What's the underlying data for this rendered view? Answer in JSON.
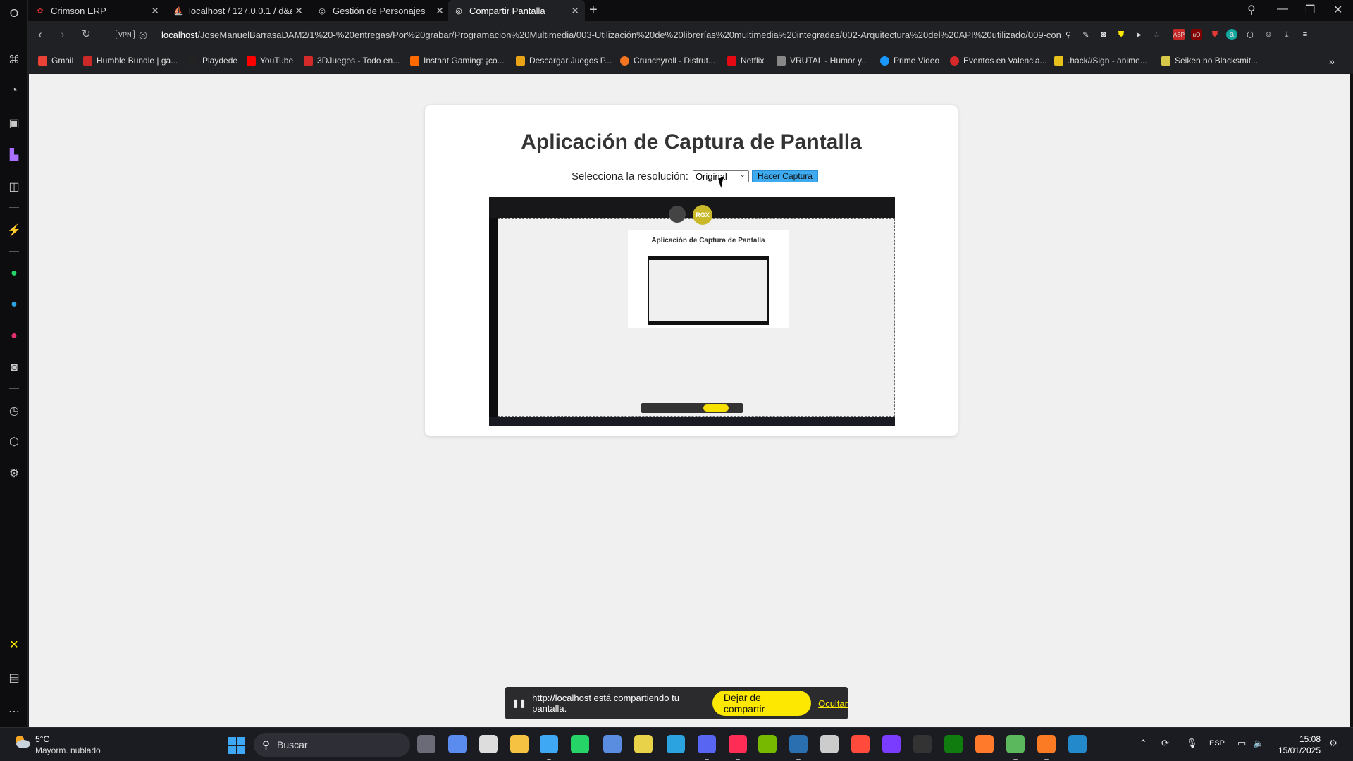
{
  "browser": {
    "tabs": [
      {
        "title": "Crimson ERP",
        "active": false
      },
      {
        "title": "localhost / 127.0.0.1 / d&a",
        "active": false
      },
      {
        "title": "Gestión de Personajes",
        "active": false
      },
      {
        "title": "Compartir Pantalla",
        "active": true
      }
    ],
    "vpn_label": "VPN",
    "url_host": "localhost",
    "url_path": "/JoseManuelBarrasaDAM2/1%20-%20entregas/Por%20grabar/Programacion%20Multimedia/003-Utilización%20de%20librerías%20multimedia%20integradas/002-Arquitectura%20del%20API%20utilizado/009-con",
    "extensions": [
      "ABP",
      "uO",
      "C",
      "a"
    ],
    "bookmarks": [
      {
        "label": "Gmail",
        "color": "#ea4335"
      },
      {
        "label": "Humble Bundle | ga...",
        "color": "#cc2929"
      },
      {
        "label": "Playdede",
        "color": "#222222"
      },
      {
        "label": "YouTube",
        "color": "#ff0000"
      },
      {
        "label": "3DJuegos - Todo en...",
        "color": "#d42a2a"
      },
      {
        "label": "Instant Gaming: ¡co...",
        "color": "#ff6a00"
      },
      {
        "label": "Descargar Juegos P...",
        "color": "#e8a317"
      },
      {
        "label": "Crunchyroll - Disfrut...",
        "color": "#f47521"
      },
      {
        "label": "Netflix",
        "color": "#e50914"
      },
      {
        "label": "VRUTAL - Humor y...",
        "color": "#888888"
      },
      {
        "label": "Prime Video",
        "color": "#1a98ff"
      },
      {
        "label": "Eventos en Valencia...",
        "color": "#d62a2a"
      },
      {
        "label": ".hack//Sign - anime...",
        "color": "#e8c21a"
      },
      {
        "label": "Seiken no Blacksmit...",
        "color": "#d8c84a"
      }
    ]
  },
  "page": {
    "title": "Aplicación de Captura de Pantalla",
    "resolution_label": "Selecciona la resolución:",
    "resolution_value": "Original",
    "capture_button": "Hacer Captura",
    "preview": {
      "title": "Aplicación de Captura de Pantalla",
      "badge": "RGX"
    }
  },
  "share_bar": {
    "text": "http://localhost está compartiendo tu pantalla.",
    "stop_button": "Dejar de compartir",
    "hide_link": "Ocultar"
  },
  "taskbar": {
    "weather_temp": "5°C",
    "weather_desc": "Mayorm. nublado",
    "search_placeholder": "Buscar",
    "language": "ESP",
    "time": "15:08",
    "date": "15/01/2025",
    "apps": [
      {
        "name": "task-view",
        "color": "#6b6b78"
      },
      {
        "name": "copilot",
        "color": "#5a8cf0"
      },
      {
        "name": "chatgpt",
        "color": "#dddddd"
      },
      {
        "name": "file-explorer",
        "color": "#f5c242"
      },
      {
        "name": "store",
        "color": "#3fa8f4"
      },
      {
        "name": "whatsapp",
        "color": "#25d366"
      },
      {
        "name": "qbittorrent",
        "color": "#5a8de0"
      },
      {
        "name": "app-yellow",
        "color": "#e8d24a"
      },
      {
        "name": "telegram",
        "color": "#2aa3e0"
      },
      {
        "name": "discord",
        "color": "#5865f2"
      },
      {
        "name": "opera-gx",
        "color": "#ff2d55"
      },
      {
        "name": "nvidia",
        "color": "#76b900"
      },
      {
        "name": "steam",
        "color": "#2a6fb0"
      },
      {
        "name": "ubisoft",
        "color": "#cccccc"
      },
      {
        "name": "ea",
        "color": "#ff4a3c"
      },
      {
        "name": "app-purple",
        "color": "#7a3cff"
      },
      {
        "name": "epic-games",
        "color": "#333333"
      },
      {
        "name": "xbox",
        "color": "#107c10"
      },
      {
        "name": "app-orange",
        "color": "#ff7a2a"
      },
      {
        "name": "app-layers",
        "color": "#5cb85c"
      },
      {
        "name": "xampp",
        "color": "#fb7a24"
      },
      {
        "name": "vscode",
        "color": "#2489ca"
      }
    ]
  }
}
